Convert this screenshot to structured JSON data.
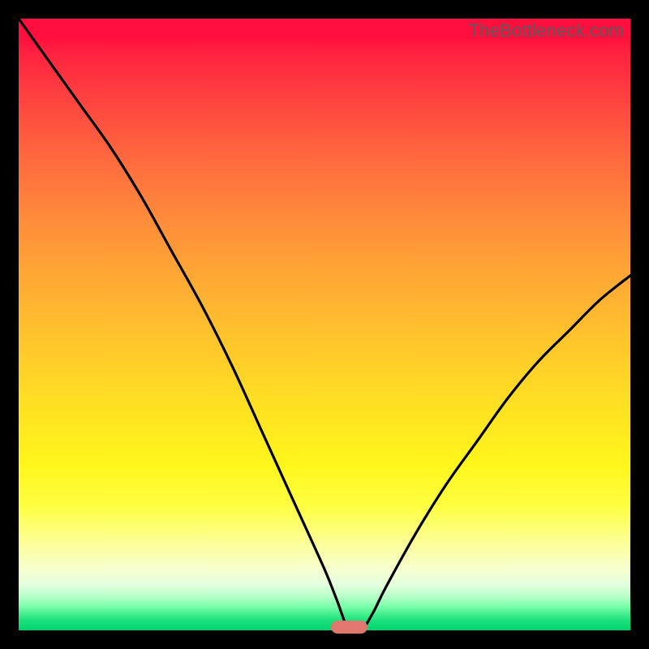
{
  "watermark": "TheBottleneck.com",
  "colors": {
    "frame": "#000000",
    "curve_stroke": "#000000",
    "marker_fill": "#e0786f",
    "gradient_top": "#ff0e3e",
    "gradient_mid": "#ffe022",
    "gradient_bottom": "#00d46b"
  },
  "chart_data": {
    "type": "line",
    "title": "",
    "subtitle": "",
    "xlabel": "",
    "ylabel": "",
    "xlim": [
      0,
      100
    ],
    "ylim": [
      0,
      100
    ],
    "legend": false,
    "grid": false,
    "annotations": [
      {
        "kind": "floor_marker",
        "x": 54,
        "width": 6,
        "y": 0.5
      }
    ],
    "series": [
      {
        "name": "bottleneck_curve",
        "x": [
          0,
          5,
          10,
          15,
          20,
          25,
          30,
          35,
          40,
          45,
          50,
          52,
          54,
          56,
          58,
          60,
          65,
          70,
          75,
          80,
          85,
          90,
          95,
          100
        ],
        "values": [
          100,
          93,
          86,
          79,
          71,
          62,
          53,
          43,
          32,
          21,
          10,
          5,
          0,
          0,
          3,
          7,
          16,
          24,
          31,
          38,
          44,
          49,
          54,
          58
        ]
      }
    ]
  }
}
